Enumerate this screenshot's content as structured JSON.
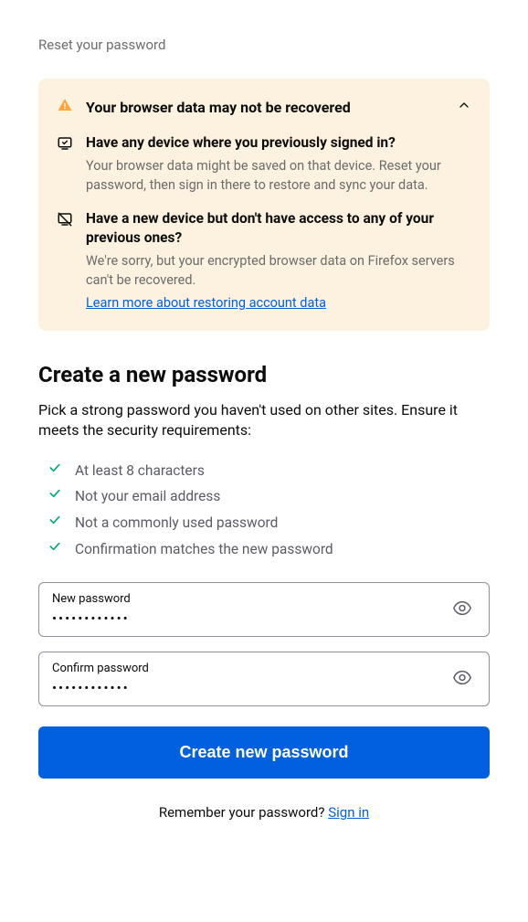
{
  "page_title": "Reset your password",
  "warning": {
    "heading": "Your browser data may not be recovered",
    "sections": [
      {
        "title": "Have any device where you previously signed in?",
        "text": "Your browser data might be saved on that device. Reset your password, then sign in there to restore and sync your data."
      },
      {
        "title": "Have a new device but don't have access to any of your previous ones?",
        "text": "We're sorry, but your encrypted browser data on Firefox servers can't be recovered.",
        "link": "Learn more about restoring account data"
      }
    ]
  },
  "create": {
    "heading": "Create a new password",
    "description": "Pick a strong password you haven't used on other sites. Ensure it meets the security requirements:",
    "requirements": [
      "At least 8 characters",
      "Not your email address",
      "Not a commonly used password",
      "Confirmation matches the new password"
    ]
  },
  "inputs": {
    "new": {
      "label": "New password",
      "value": "••••••••••••"
    },
    "confirm": {
      "label": "Confirm password",
      "value": "••••••••••••"
    }
  },
  "submit_label": "Create new password",
  "footer": {
    "text": "Remember your password? ",
    "link": "Sign in"
  }
}
